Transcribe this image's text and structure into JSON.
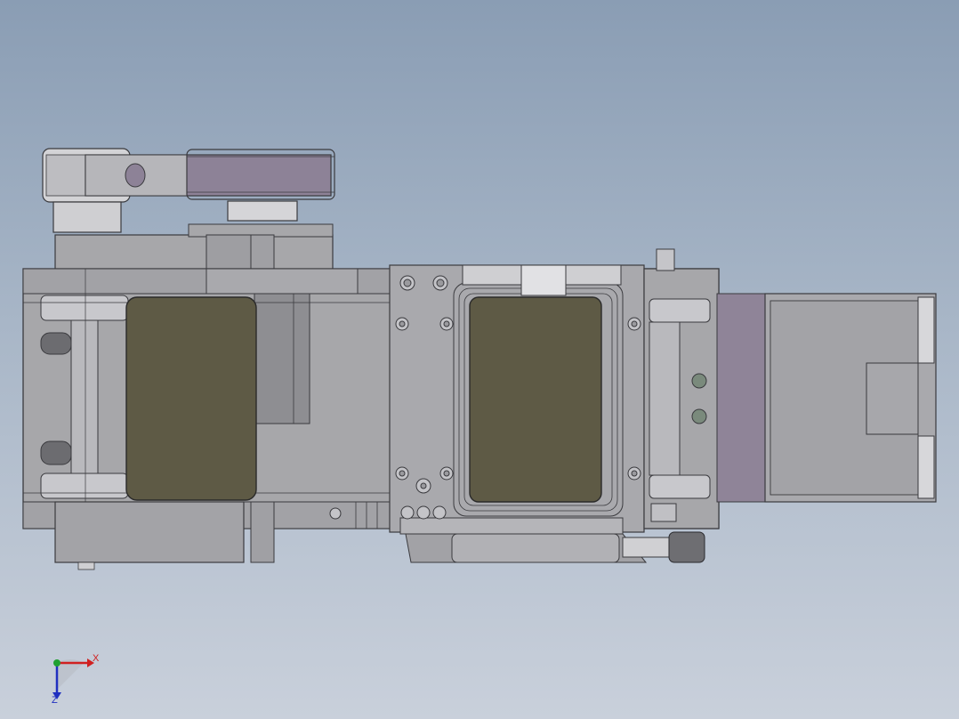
{
  "viewport": {
    "background_top": "#8a9db4",
    "background_bottom": "#c9d0db"
  },
  "model": {
    "body_color": "#a7a7aa",
    "body_dark": "#8e8e92",
    "edge_color": "#3a3a3e",
    "pad_color": "#5e5a45",
    "pulley_color": "#d3d3d6",
    "belt_color": "#8d8297",
    "tray_color": "#8f8498",
    "tray_inner": "#a9a9ad"
  },
  "triad": {
    "x_label": "X",
    "z_label": "Z",
    "x_color": "#d02020",
    "y_color": "#20a030",
    "z_color": "#2030c0"
  }
}
